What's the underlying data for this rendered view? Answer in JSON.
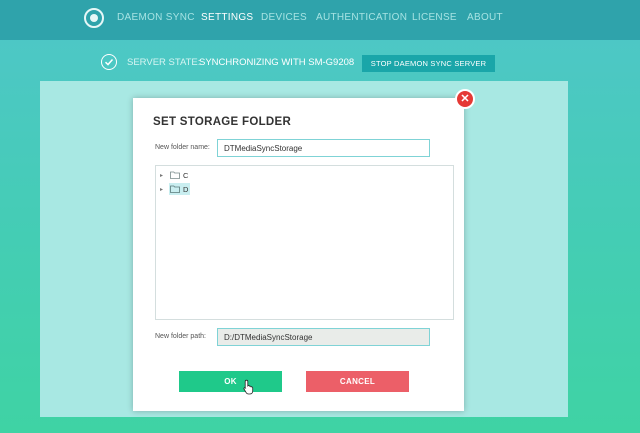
{
  "nav": {
    "items": [
      {
        "label": "DAEMON SYNC",
        "active": false
      },
      {
        "label": "SETTINGS",
        "active": true
      },
      {
        "label": "DEVICES",
        "active": false
      },
      {
        "label": "AUTHENTICATION",
        "active": false
      },
      {
        "label": "LICENSE",
        "active": false
      },
      {
        "label": "ABOUT",
        "active": false
      }
    ]
  },
  "server_state": {
    "label": "SERVER STATE:",
    "value": "SYNCHRONIZING WITH SM-G9208",
    "stop_button": "STOP DAEMON SYNC SERVER"
  },
  "dialog": {
    "title": "SET STORAGE FOLDER",
    "folder_name_label": "New folder name:",
    "folder_name_value": "DTMediaSyncStorage",
    "tree": [
      {
        "label": "C",
        "selected": false
      },
      {
        "label": "D",
        "selected": true
      }
    ],
    "folder_path_label": "New folder path:",
    "folder_path_value": "D:/DTMediaSyncStorage",
    "ok_label": "OK",
    "cancel_label": "CANCEL"
  },
  "colors": {
    "nav_bg": "#2fa3ab",
    "accent": "#1aa6a9",
    "ok": "#1fc98a",
    "cancel": "#ec5f68",
    "close": "#e53935"
  },
  "icons": {
    "logo": "daemon-sync-logo",
    "state": "check-circle-icon",
    "close": "close-icon",
    "folder": "folder-icon",
    "expander": "caret-right-icon",
    "cursor": "hand-pointer-icon"
  }
}
